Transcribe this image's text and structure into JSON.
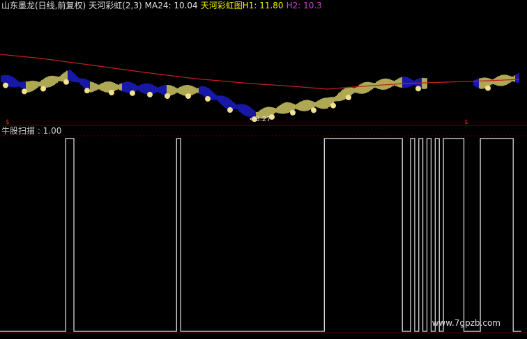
{
  "header": {
    "name": "山东墨龙(日线,前复权)",
    "indicator": "天河彩虹(2,3)",
    "ma_label": "MA24: 10.04",
    "rainbow_label": "天河彩虹图H1: 11.80",
    "h2_label": "H2: 10.3"
  },
  "chart": {
    "low_label": "←8.27",
    "coin_glyph": "$",
    "sub_title": "牛股扫描 : 1.00"
  },
  "watermark": "www.7gpzb.com",
  "colors": {
    "background": "#000000",
    "ma_line": "#c02020",
    "rainbow_up": "#e8e070",
    "rainbow_down": "#2020e0",
    "coin": "#f0e090",
    "grid": "#600000",
    "scan_line": "#e8e8e8",
    "name_text": "#e0e0e0",
    "ma_text": "#e0e0e0",
    "rainbow_text": "#f0f000",
    "h2_text": "#d040d0"
  },
  "chart_data": {
    "type": "line",
    "series": [
      {
        "values": [
          0,
          0,
          0,
          0,
          0,
          0,
          0,
          0,
          0,
          0,
          0,
          0,
          0,
          0,
          0,
          0,
          1,
          1,
          0,
          0,
          0,
          0,
          0,
          0,
          0,
          0,
          0,
          0,
          0,
          0,
          0,
          0,
          0,
          0,
          0,
          0,
          0,
          0,
          0,
          0,
          0,
          0,
          0,
          1,
          0,
          0,
          0,
          0,
          0,
          0,
          0,
          0,
          0,
          0,
          0,
          0,
          0,
          0,
          0,
          0,
          0,
          0,
          0,
          0,
          0,
          0,
          0,
          0,
          0,
          0,
          0,
          0,
          0,
          0,
          0,
          0,
          0,
          0,
          0,
          1,
          1,
          1,
          1,
          1,
          1,
          1,
          1,
          1,
          1,
          1,
          1,
          1,
          1,
          1,
          1,
          1,
          1,
          1,
          0,
          0,
          1,
          0,
          1,
          0,
          1,
          0,
          1,
          0,
          1,
          1,
          1,
          1,
          1,
          0,
          0,
          0,
          0,
          1,
          1,
          1,
          1,
          1,
          1,
          1,
          1,
          0,
          0,
          0
        ]
      }
    ]
  }
}
